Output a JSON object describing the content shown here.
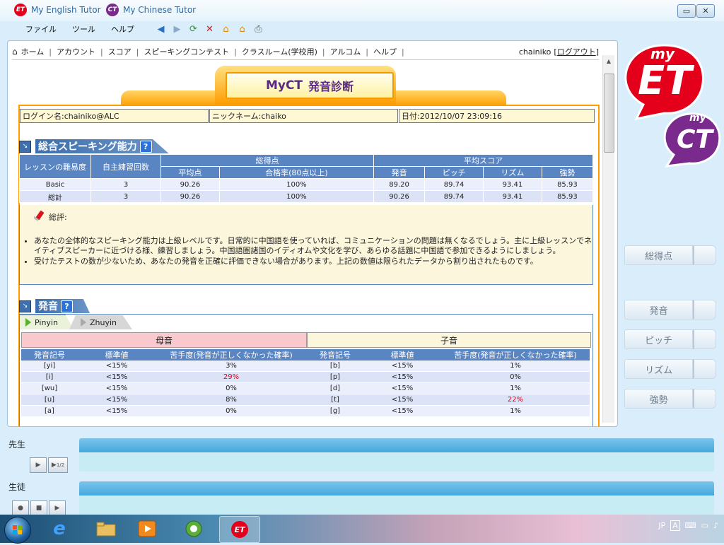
{
  "window": {
    "tab_english": "My English Tutor",
    "tab_chinese": "My Chinese Tutor",
    "logo_et": "ET",
    "logo_ct": "CT",
    "minimize": "▭",
    "close": "✕"
  },
  "menu": {
    "file": "ファイル",
    "tools": "ツール",
    "help": "ヘルプ"
  },
  "navbar": {
    "items": [
      "ホーム",
      "アカウント",
      "スコア",
      "スピーキングコンテスト",
      "クラスルーム(学校用)",
      "アルコム",
      "ヘルプ"
    ],
    "user": "chainiko",
    "logout": "ログアウト",
    "bracket_open": "[",
    "bracket_close": "]"
  },
  "banner": {
    "title": "MyCT",
    "subtitle": "発音診断"
  },
  "info": {
    "login": "ログイン名:chainiko@ALC",
    "nickname": "ニックネーム:chaiko",
    "date": "日付:2012/10/07 23:09:16"
  },
  "section1": {
    "title": "総合スピーキング能力",
    "help": "?",
    "headers": {
      "level": "レッスンの難易度",
      "practice": "自主練習回数",
      "total_group": "総得点",
      "avg_group": "平均スコア",
      "avg_points": "平均点",
      "pass_rate": "合格率(80点以上)",
      "pron": "発音",
      "pitch": "ピッチ",
      "rhythm": "リズム",
      "stress": "強勢"
    },
    "rows": [
      {
        "level": "Basic",
        "practice": "3",
        "avg": "90.26",
        "pass": "100%",
        "pron": "89.20",
        "pitch": "89.74",
        "rhythm": "93.41",
        "stress": "85.93"
      },
      {
        "level": "総計",
        "practice": "3",
        "avg": "90.26",
        "pass": "100%",
        "pron": "90.26",
        "pitch": "89.74",
        "rhythm": "93.41",
        "stress": "85.93"
      }
    ],
    "review_label": "総評:",
    "review": [
      "あなたの全体的なスピーキング能力は上級レベルです。日常的に中国語を使っていれば、コミュニケーションの問題は無くなるでしょう。主に上級レッスンでネイティブスピーカーに近づける様、練習しましょう。中国語圏諸国のイディオムや文化を学び、あらゆる話題に中国語で参加できるようにしましょう。",
      "受けたテストの数が少ないため、あなたの発音を正確に評価できない場合があります。上記の数値は限られたデータから割り出されたものです。"
    ]
  },
  "section2": {
    "title": "発音",
    "help": "?",
    "tabs": {
      "pinyin": "Pinyin",
      "zhuyin": "Zhuyin"
    },
    "vowels_label": "母音",
    "consonants_label": "子音",
    "col_symbol": "発音記号",
    "col_standard": "標準値",
    "col_difficulty": "苦手度(発音が正しくなかった確率)",
    "vowels": [
      {
        "sym": "[yi]",
        "std": "<15%",
        "diff": "3%",
        "warn": false
      },
      {
        "sym": "[i]",
        "std": "<15%",
        "diff": "29%",
        "warn": true
      },
      {
        "sym": "[wu]",
        "std": "<15%",
        "diff": "0%",
        "warn": false
      },
      {
        "sym": "[u]",
        "std": "<15%",
        "diff": "8%",
        "warn": false
      },
      {
        "sym": "[a]",
        "std": "<15%",
        "diff": "0%",
        "warn": false
      }
    ],
    "consonants": [
      {
        "sym": "[b]",
        "std": "<15%",
        "diff": "1%",
        "warn": false
      },
      {
        "sym": "[p]",
        "std": "<15%",
        "diff": "0%",
        "warn": false
      },
      {
        "sym": "[d]",
        "std": "<15%",
        "diff": "1%",
        "warn": false
      },
      {
        "sym": "[t]",
        "std": "<15%",
        "diff": "22%",
        "warn": true
      },
      {
        "sym": "[g]",
        "std": "<15%",
        "diff": "1%",
        "warn": false
      }
    ]
  },
  "side_buttons": [
    "総得点",
    "発音",
    "ピッチ",
    "リズム",
    "強勢"
  ],
  "logos": {
    "big": "ET",
    "big_prefix": "my",
    "small": "CT",
    "small_prefix": "my"
  },
  "bottom": {
    "teacher": "先生",
    "student": "生徒",
    "half_speed": "1/2"
  },
  "tray": {
    "lang": "JP"
  },
  "colors": {
    "accent_orange": "#ff9c00",
    "header_blue": "#5a85c3",
    "warn_red": "#e0001b",
    "logo_red": "#e4001b",
    "logo_purple": "#7a2a8c"
  }
}
